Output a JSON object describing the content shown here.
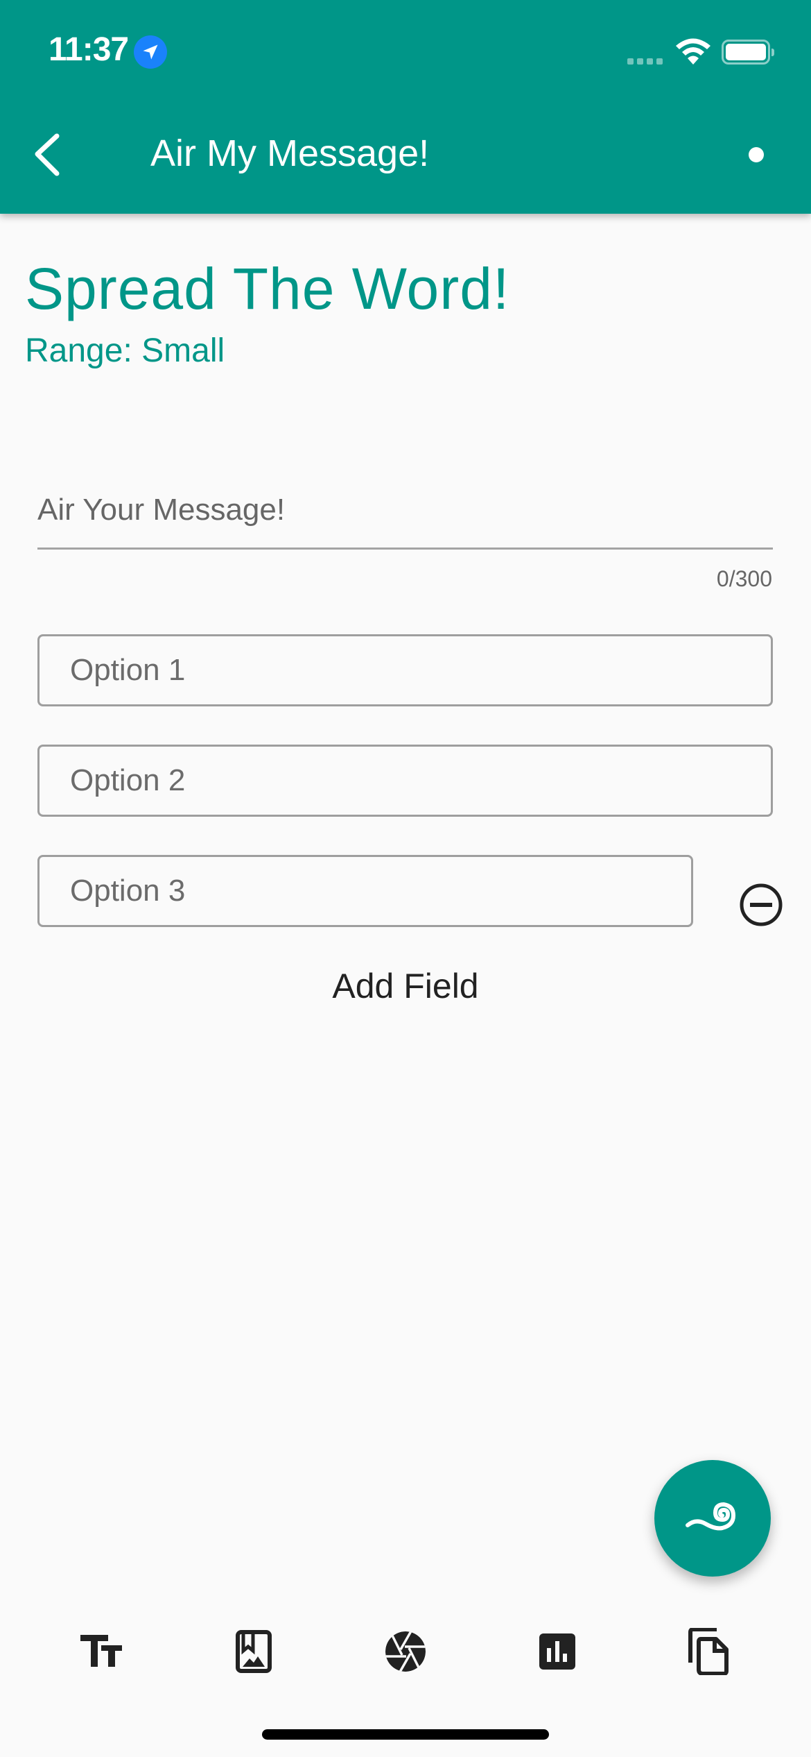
{
  "status_bar": {
    "time": "11:37",
    "icons": [
      "location-arrow-icon",
      "cellular-signal-icon",
      "wifi-icon",
      "battery-icon"
    ]
  },
  "app_bar": {
    "title": "Air My Message!",
    "back_icon": "chevron-left-icon",
    "menu_icon": "dot-icon"
  },
  "page": {
    "heading": "Spread The Word!",
    "range": "Range: Small"
  },
  "message": {
    "value": "",
    "placeholder": "Air Your Message!",
    "counter": "0/300"
  },
  "options": [
    {
      "value": "",
      "placeholder": "Option 1",
      "removable": false
    },
    {
      "value": "",
      "placeholder": "Option 2",
      "removable": false
    },
    {
      "value": "",
      "placeholder": "Option 3",
      "removable": true
    }
  ],
  "add_field_label": "Add Field",
  "fab": {
    "icon": "wind-spiral-icon"
  },
  "toolbar": {
    "items": [
      {
        "name": "text-size",
        "icon": "text-fields-icon"
      },
      {
        "name": "photo-album",
        "icon": "photo-album-icon"
      },
      {
        "name": "camera",
        "icon": "camera-aperture-icon"
      },
      {
        "name": "poll",
        "icon": "bar-chart-icon"
      },
      {
        "name": "copy",
        "icon": "file-copy-icon"
      }
    ]
  },
  "colors": {
    "primary": "#009688",
    "background": "#fafafa",
    "text_dark": "#222222",
    "text_muted": "#666666",
    "outline": "#9e9e9e",
    "location_badge": "#1a82fb"
  }
}
